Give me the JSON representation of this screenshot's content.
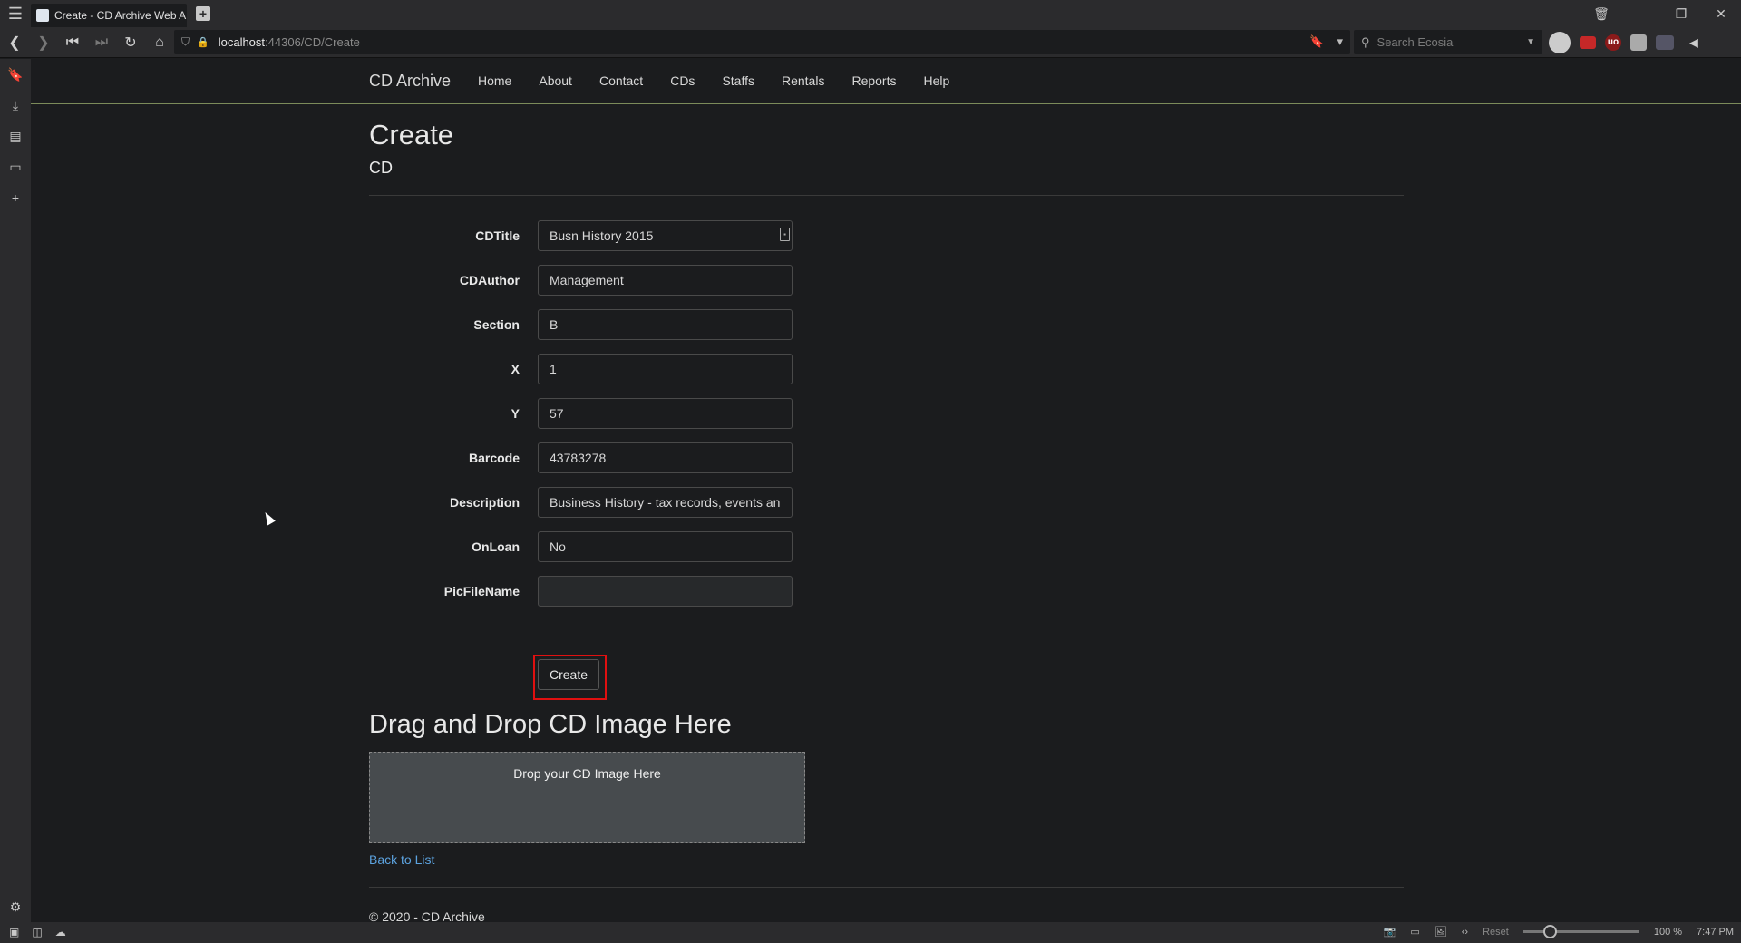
{
  "browser": {
    "tab_title": "Create - CD Archive Web A",
    "url_host": "localhost",
    "url_path": ":44306/CD/Create",
    "search_placeholder": "Search Ecosia",
    "status": {
      "reset_label": "Reset",
      "zoom": "100 %",
      "time": "7:47 PM"
    }
  },
  "site": {
    "brand": "CD Archive",
    "menu": [
      "Home",
      "About",
      "Contact",
      "CDs",
      "Staffs",
      "Rentals",
      "Reports",
      "Help"
    ],
    "footer": "© 2020 - CD Archive"
  },
  "page": {
    "title": "Create",
    "subtitle": "CD",
    "fields": [
      {
        "label": "CDTitle",
        "value": "Busn History 2015"
      },
      {
        "label": "CDAuthor",
        "value": "Management"
      },
      {
        "label": "Section",
        "value": "B"
      },
      {
        "label": "X",
        "value": "1"
      },
      {
        "label": "Y",
        "value": "57"
      },
      {
        "label": "Barcode",
        "value": "43783278"
      },
      {
        "label": "Description",
        "value": "Business History - tax records, events an"
      },
      {
        "label": "OnLoan",
        "value": "No"
      },
      {
        "label": "PicFileName",
        "value": ""
      }
    ],
    "create_label": "Create",
    "dropzone_heading": "Drag and Drop CD Image Here",
    "dropzone_text": "Drop your CD Image Here",
    "back_link": "Back to List"
  }
}
